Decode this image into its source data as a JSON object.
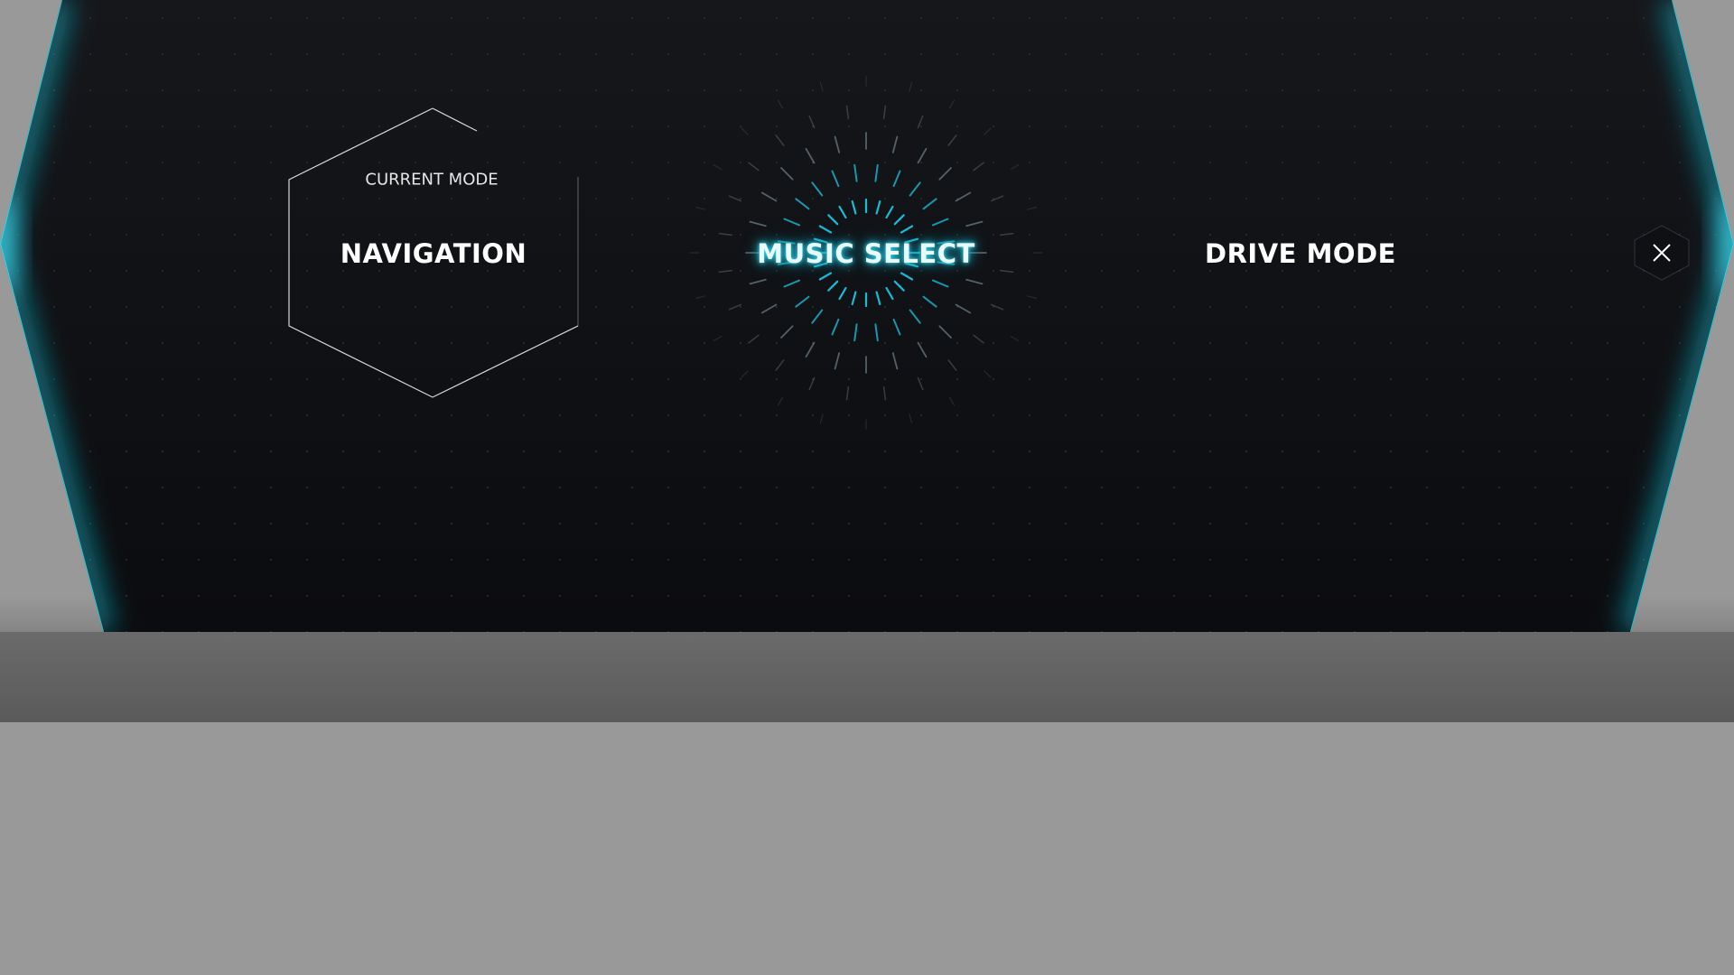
{
  "mode_selector": {
    "current_mode_caption": "CURRENT MODE",
    "modes": [
      {
        "label": "NAVIGATION",
        "state": "current"
      },
      {
        "label": "MUSIC SELECT",
        "state": "highlighted"
      },
      {
        "label": "DRIVE MODE",
        "state": "idle"
      }
    ],
    "close_icon": "close-icon"
  },
  "colors": {
    "panel": "#101216",
    "accent": "#19c6e0",
    "text": "#ffffff",
    "backdrop": "#999999"
  }
}
